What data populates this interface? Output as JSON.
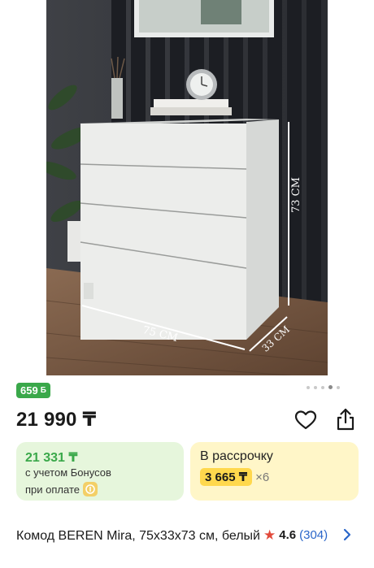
{
  "gallery": {
    "dimension_height": "73 CM",
    "dimension_width": "75 CM",
    "dimension_depth": "33 CM",
    "page_count": 5,
    "active_page": 4
  },
  "bonus_badge": {
    "value": "659",
    "currency_icon": "Б"
  },
  "price": {
    "value": "21 990 ₸"
  },
  "bonus_card": {
    "price": "21 331 ₸",
    "line1": "с учетом Бонусов",
    "line2": "при оплате",
    "icon": "bonus-coin-icon"
  },
  "installment_card": {
    "title": "В рассрочку",
    "amount": "3 665 ₸",
    "multiplier": "×6"
  },
  "product": {
    "title": "Комод BEREN Mira, 75x33x73 см, белый",
    "rating": "4.6",
    "reviews": "(304)"
  },
  "colors": {
    "bonus_green": "#3aa84a",
    "installment_yellow": "#ffd84d",
    "link_blue": "#2a66c9",
    "star_red": "#e24a3b"
  }
}
